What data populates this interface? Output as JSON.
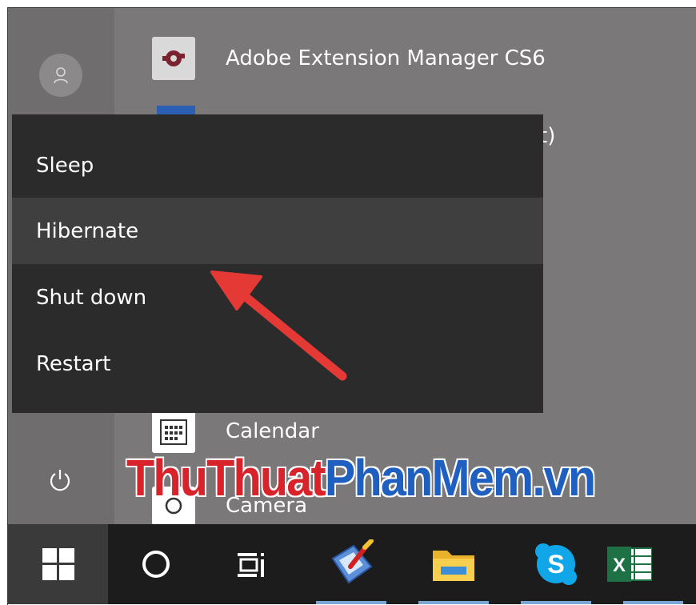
{
  "apps": [
    {
      "name": "adobe-extension-manager",
      "label": "Adobe Extension Manager CS6",
      "icon": "adobe-extension-icon"
    },
    {
      "name": "calendar",
      "label": "Calendar",
      "icon": "calendar-icon"
    },
    {
      "name": "camera",
      "label": "Camera",
      "icon": "camera-icon"
    }
  ],
  "partial_app_text": "t)",
  "power_menu": {
    "items": [
      "Sleep",
      "Hibernate",
      "Shut down",
      "Restart"
    ],
    "highlighted": "Hibernate"
  },
  "watermark": {
    "part1": "ThuThuat",
    "part2": "PhanMem.vn"
  },
  "taskbar": {
    "icons": [
      "windows-start-icon",
      "cortana-search-icon",
      "task-view-icon",
      "paint-app-icon",
      "file-explorer-icon",
      "skype-icon",
      "excel-icon"
    ]
  },
  "colors": {
    "menu_bg": "#2b2b2b",
    "menu_hover": "#3f3f3f",
    "start_bg": "#7a7878",
    "taskbar_bg": "#1c1c1c",
    "arrow": "#e53935"
  }
}
